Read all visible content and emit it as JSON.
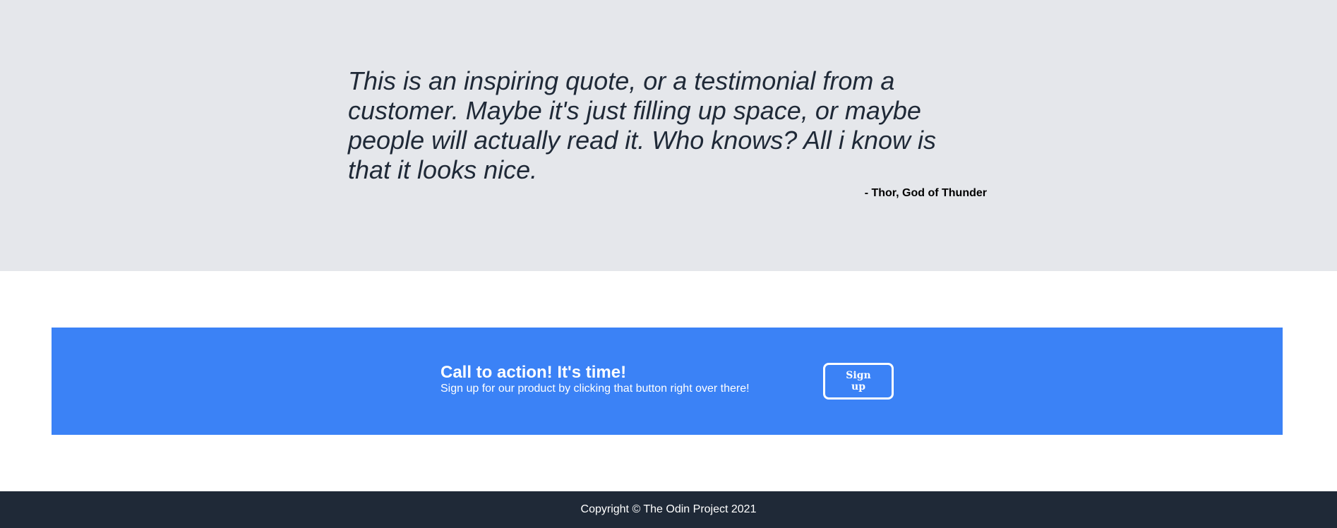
{
  "quote": {
    "text": "This is an inspiring quote, or a testimonial from a customer. Maybe it's just filling up space, or maybe people will actually read it. Who knows? All i know is that it looks nice.",
    "author": "- Thor, God of Thunder"
  },
  "cta": {
    "heading": "Call to action! It's time!",
    "subtext": "Sign up for our product by clicking that button right over there!",
    "button_label": "Sign up"
  },
  "footer": {
    "copyright": "Copyright © The Odin Project 2021"
  },
  "colors": {
    "quote_background": "#e5e7eb",
    "cta_background": "#3b82f6",
    "footer_background": "#1f2937",
    "text_dark": "#1f2937"
  }
}
